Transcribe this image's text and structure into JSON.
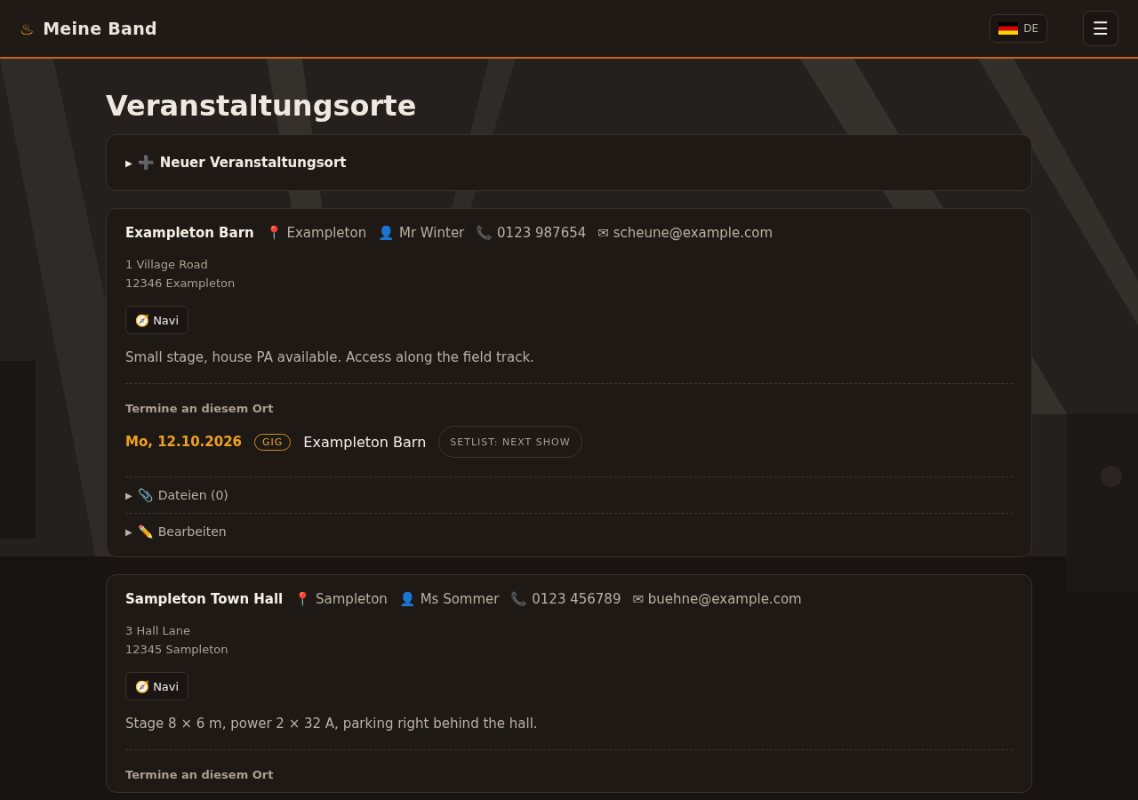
{
  "header": {
    "logo": "♨",
    "title": "Meine Band",
    "language": "DE",
    "menu": "☰"
  },
  "page_title": "Veranstaltungsorte",
  "new_venue": {
    "caret": "▶",
    "icon": "➕",
    "label": "Neuer Veranstaltungsort",
    "expanded": false
  },
  "venues": [
    {
      "name": "Exampleton Barn",
      "city_icon": "📍",
      "city": "Exampleton",
      "contact_icon": "👤",
      "contact": "Mr Winter",
      "phone_icon": "📞",
      "phone": "0123 987654",
      "email_icon": "✉",
      "email": "scheune@example.com",
      "address": [
        "1 Village Road",
        "12346 Exampleton"
      ],
      "navi": {
        "icon": "🧭",
        "label": "Navi"
      },
      "notes": "Small stage, house PA available. Access along the field track.",
      "events_heading": "Termine an diesem Ort",
      "events": [
        {
          "date": "Mo, 12.10.2026",
          "type": "GIG",
          "venue": "Exampleton Barn",
          "setlist": "SETLIST: NEXT SHOW"
        }
      ],
      "sections": [
        {
          "caret": "▶",
          "icon": "📎",
          "label": "Dateien (0)",
          "expanded": false
        },
        {
          "caret": "▶",
          "icon": "✏️",
          "label": "Bearbeiten",
          "expanded": false
        }
      ]
    },
    {
      "name": "Sampleton Town Hall",
      "city_icon": "📍",
      "city": "Sampleton",
      "contact_icon": "👤",
      "contact": "Ms Sommer",
      "phone_icon": "📞",
      "phone": "0123 456789",
      "email_icon": "✉",
      "email": "buehne@example.com",
      "address": [
        "3 Hall Lane",
        "12345 Sampleton"
      ],
      "navi": {
        "icon": "🧭",
        "label": "Navi"
      },
      "notes": "Stage 8 × 6 m, power 2 × 32 A, parking right behind the hall.",
      "events_heading": "Termine an diesem Ort"
    }
  ]
}
